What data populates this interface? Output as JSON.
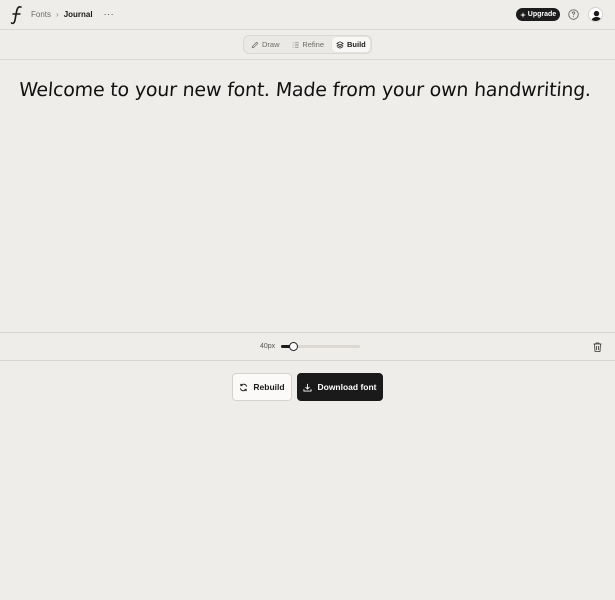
{
  "breadcrumb": {
    "parent": "Fonts",
    "current": "Journal",
    "more": "···"
  },
  "header": {
    "upgrade_label": "Upgrade",
    "help_icon": "help-circle-icon",
    "avatar_icon": "user-icon",
    "logo_icon": "script-f-icon"
  },
  "modes": [
    {
      "label": "Draw",
      "icon": "pencil-icon",
      "active": false
    },
    {
      "label": "Refine",
      "icon": "list-icon",
      "active": false
    },
    {
      "label": "Build",
      "icon": "layers-icon",
      "active": true
    }
  ],
  "preview": {
    "text": "Welcome to your new font. Made from your own handwriting."
  },
  "size_control": {
    "label": "40px",
    "value_fraction": 0.15
  },
  "actions": {
    "rebuild_label": "Rebuild",
    "download_label": "Download font",
    "delete_icon": "trash-icon"
  },
  "colors": {
    "background": "#efedea",
    "primary": "#1a1a1a",
    "border": "#dcd9d4"
  }
}
